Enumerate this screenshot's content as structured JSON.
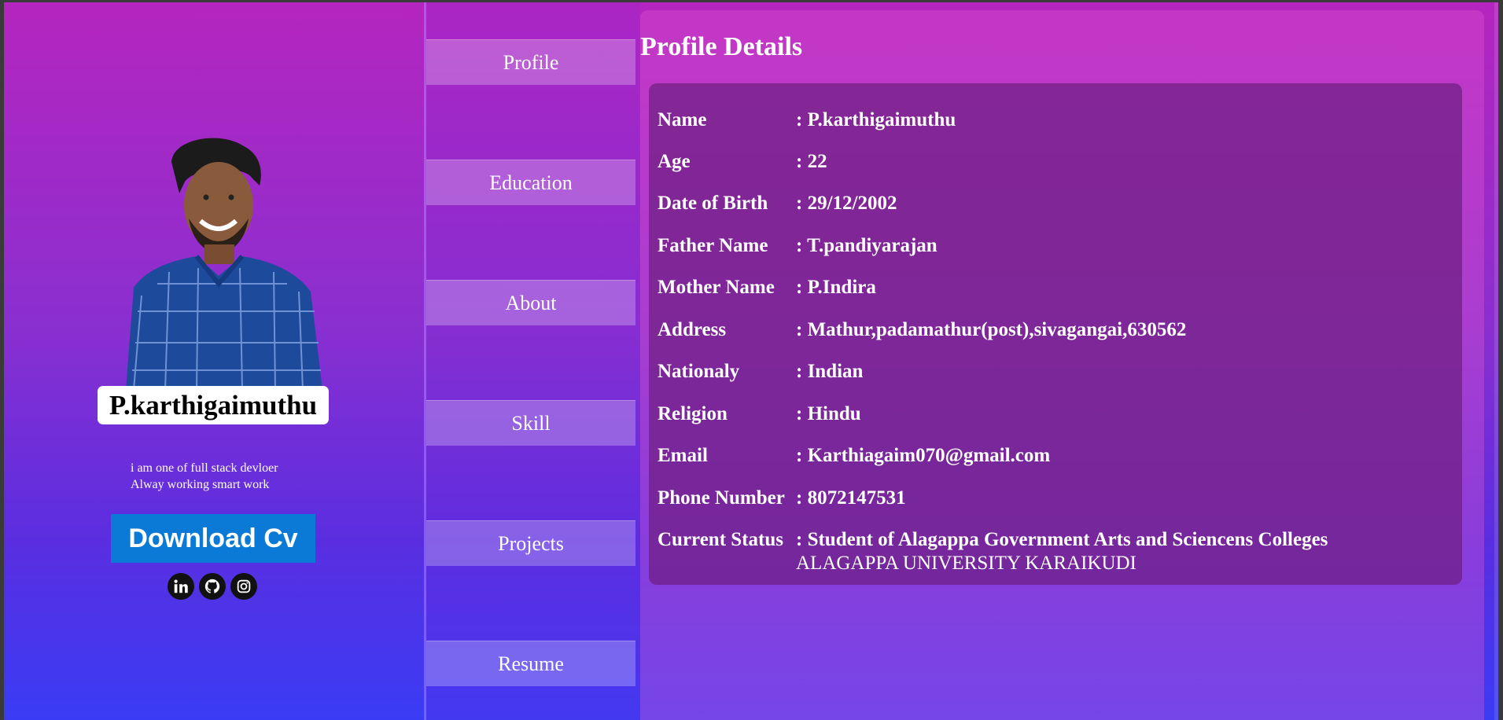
{
  "profile": {
    "name": "P.karthigaimuthu",
    "bio_line1": "i am one of full stack devloer",
    "bio_line2": "Alway working smart work",
    "download_label": "Download Cv",
    "socials": [
      "linkedin-icon",
      "github-icon",
      "instagram-icon"
    ]
  },
  "nav": {
    "items": [
      {
        "label": "Profile"
      },
      {
        "label": "Education"
      },
      {
        "label": "About"
      },
      {
        "label": "Skill"
      },
      {
        "label": "Projects"
      },
      {
        "label": "Resume"
      }
    ]
  },
  "details": {
    "title": "Profile Details",
    "rows": [
      {
        "label": "Name",
        "value": ": P.karthigaimuthu"
      },
      {
        "label": "Age",
        "value": ": 22"
      },
      {
        "label": "Date of Birth",
        "value": ": 29/12/2002"
      },
      {
        "label": "Father Name",
        "value": ": T.pandiyarajan"
      },
      {
        "label": "Mother Name",
        "value": ": P.Indira"
      },
      {
        "label": "Address",
        "value": ": Mathur,padamathur(post),sivagangai,630562"
      },
      {
        "label": "Nationaly",
        "value": ": Indian"
      },
      {
        "label": "Religion",
        "value": ": Hindu"
      },
      {
        "label": "Email",
        "value": ": Karthiagaim070@gmail.com"
      },
      {
        "label": "Phone Number",
        "value": ": 8072147531"
      },
      {
        "label": "Current Status",
        "value": ": Student of Alagappa Government Arts and Sciencens Colleges",
        "value_line2": "ALAGAPPA UNIVERSITY KARAIKUDI"
      }
    ]
  },
  "colors": {
    "download_button": "#0a7ad6",
    "gradient_top": "#b525bf",
    "gradient_bottom": "#3a3cf5"
  }
}
